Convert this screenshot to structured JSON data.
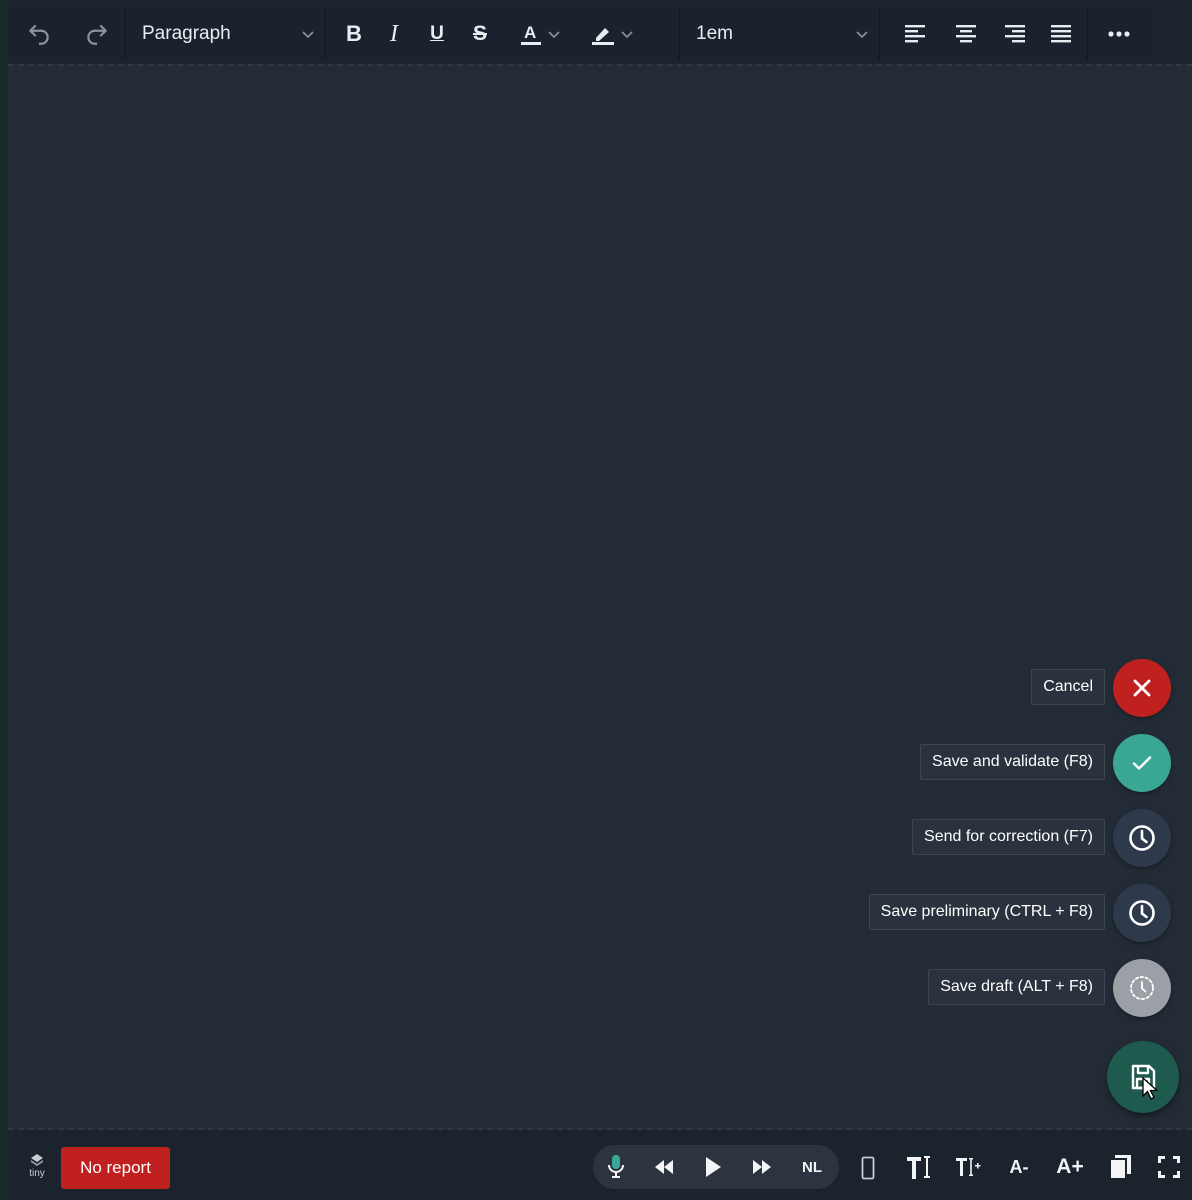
{
  "toolbar": {
    "block_format": "Paragraph",
    "font_size": "1em",
    "icons": [
      "undo-icon",
      "redo-icon",
      "bold-icon",
      "italic-icon",
      "underline-icon",
      "strikethrough-icon",
      "text-color-icon",
      "highlight-icon",
      "align-left-icon",
      "align-center-icon",
      "align-right-icon",
      "justify-icon",
      "more-icon"
    ]
  },
  "actions": {
    "cancel": "Cancel",
    "save_validate": "Save and validate (F8)",
    "send_correction": "Send for correction (F7)",
    "save_preliminary": "Save preliminary (CTRL + F8)",
    "save_draft": "Save draft (ALT + F8)"
  },
  "colors": {
    "cancel": "#c0201f",
    "validate": "#3aa796",
    "correction": "#2e3a4c",
    "preliminary": "#2e3a4c",
    "draft": "#9aa0a6",
    "main_fab": "#1f5a4e"
  },
  "statusbar": {
    "logo_text": "tiny",
    "report_button": "No report",
    "language": "NL",
    "font_decrease": "A-",
    "font_increase": "A+"
  }
}
